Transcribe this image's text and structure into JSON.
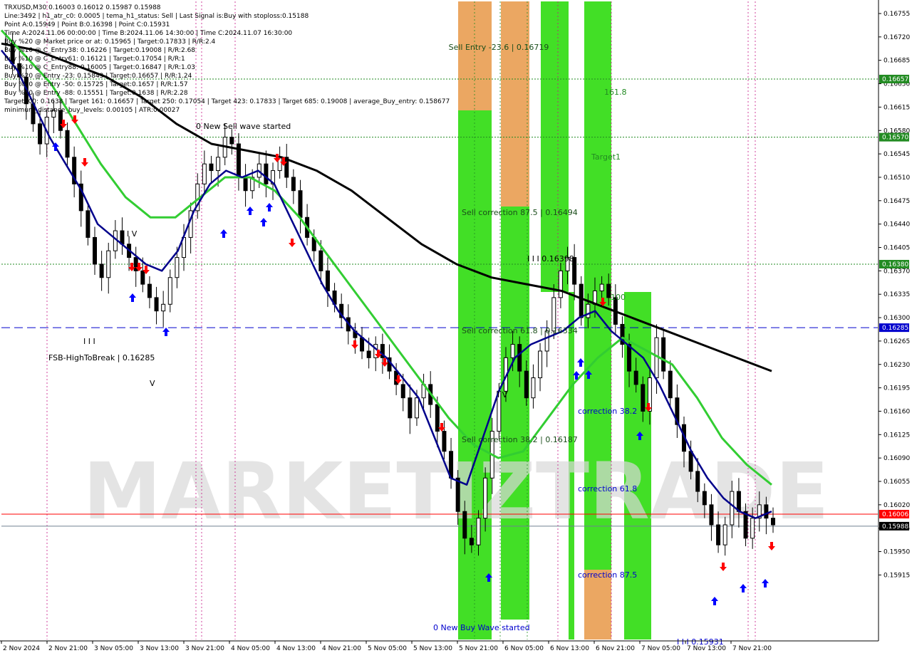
{
  "info_panel": {
    "lines": [
      "TRXUSD,M30  0.16003 0.16012 0.15987 0.15988",
      "Line:3492 | h1_atr_c0: 0.0005 | tema_h1_status: Sell | Last Signal is:Buy with stoploss:0.15188",
      "Point A:0.15949 | Point B:0.16398 | Point C:0.15931",
      "Time A:2024.11.06 00:00:00 | Time B:2024.11.06 14:30:00 | Time C:2024.11.07 16:30:00",
      "Buy %20 @ Market price or at: 0.15965 | Target:0.17833 | R/R:2.4",
      "Buy %10 @ C_Entry38: 0.16226 | Target:0.19008 | R/R:2.68",
      "Buy %10 @ C_Entry61: 0.16121 | Target:0.17054 | R/R:1",
      "Buy %10 @ C_Entry88: 0.16005 | Target:0.16847 | R/R:1.03",
      "Buy %20 @ Entry -23: 0.15843 | Target:0.16657 | R/R:1.24",
      "Buy %20 @ Entry -50: 0.15725 | Target:0.1657 | R/R:1.57",
      "Buy %20 @ Entry -88: 0.15551 | Target:0.1638 | R/R:2.28",
      "Target100: 0.1638 | Target 161: 0.16657 | Target 250: 0.17054 | Target 423: 0.17833 | Target 685: 0.19008 | average_Buy_entry: 0.158677",
      "minimum_distance_buy_levels: 0.00105 | ATR:0.00027"
    ]
  },
  "watermark": "MARKETIZTRADE",
  "annotations": {
    "sell_entry": "Sell Entry -23.6 | 0.16719",
    "sell_corr_875": "Sell correction 87.5 | 0.16494",
    "sell_corr_618": "Sell correction 61.8 | 0.16334",
    "sell_corr_382": "Sell correction 38.2 | 0.16187",
    "point_b": "I I I 0.16398",
    "new_sell_wave": "0 New Sell wave started",
    "new_buy_wave": "0 New Buy Wave started",
    "fsb": "FSB-HighToBreak | 0.16285",
    "t1618": "161.8",
    "target1": "Target1",
    "t100": "100",
    "corr_382": "correction 38.2",
    "corr_618": "correction 61.8",
    "corr_875": "correction 87.5",
    "iv": "I V",
    "iii": "I I I",
    "v": "V",
    "iv2": "I V",
    "bottom_label": "I I I 0.15931"
  },
  "colors": {
    "background": "#ffffff",
    "candle": "#000000",
    "ma_fast": "#00008b",
    "ma_mid": "#32cd32",
    "ma_slow": "#000000",
    "zone_green": "#32dc14",
    "zone_orange": "#e9a055",
    "level_green": "#228b22",
    "fsb_line": "#0000cd",
    "current_price": "#ff0000",
    "bid_line": "#708090",
    "buy_arrow": "#0000ff",
    "sell_arrow": "#ff0000",
    "grid_vertical_magenta": "#c71585"
  },
  "chart_data": {
    "type": "candlestick",
    "symbol": "TRXUSD",
    "timeframe": "M30",
    "ylim": [
      0.1592,
      0.1678
    ],
    "y_ticks": [
      "0.16755",
      "0.16720",
      "0.16685",
      "0.16650",
      "0.16615",
      "0.16580",
      "0.16545",
      "0.16510",
      "0.16475",
      "0.16440",
      "0.16405",
      "0.16370",
      "0.16335",
      "0.16300",
      "0.16265",
      "0.16230",
      "0.16195",
      "0.16160",
      "0.16125",
      "0.16090",
      "0.16055",
      "0.16020",
      "0.15985",
      "0.15950",
      "0.15915"
    ],
    "x_ticks": [
      "2 Nov 2024",
      "2 Nov 21:00",
      "3 Nov 05:00",
      "3 Nov 13:00",
      "3 Nov 21:00",
      "4 Nov 05:00",
      "4 Nov 13:00",
      "4 Nov 21:00",
      "5 Nov 05:00",
      "5 Nov 13:00",
      "5 Nov 21:00",
      "6 Nov 05:00",
      "6 Nov 13:00",
      "6 Nov 21:00",
      "7 Nov 05:00",
      "7 Nov 13:00",
      "7 Nov 21:00"
    ],
    "price_tags": [
      {
        "value": "0.16657",
        "color": "#228b22"
      },
      {
        "value": "0.16570",
        "color": "#228b22"
      },
      {
        "value": "0.16380",
        "color": "#228b22"
      },
      {
        "value": "0.16285",
        "color": "#0000cd"
      },
      {
        "value": "0.16006",
        "color": "#ff0000"
      },
      {
        "value": "0.15988",
        "color": "#000000"
      }
    ],
    "horizontal_levels": [
      {
        "price": 0.16657,
        "style": "dotted",
        "color": "#228b22"
      },
      {
        "price": 0.1657,
        "style": "dotted",
        "color": "#228b22"
      },
      {
        "price": 0.1638,
        "style": "dotted",
        "color": "#228b22"
      },
      {
        "price": 0.16285,
        "style": "dashed",
        "color": "#0000cd"
      },
      {
        "price": 0.16006,
        "style": "solid",
        "color": "#ff0000"
      },
      {
        "price": 0.15988,
        "style": "solid",
        "color": "#708090"
      }
    ],
    "close_path": [
      0.1671,
      0.1668,
      0.1666,
      0.1662,
      0.1659,
      0.1656,
      0.166,
      0.1661,
      0.1658,
      0.1654,
      0.165,
      0.1646,
      0.1642,
      0.1638,
      0.1636,
      0.164,
      0.1643,
      0.1641,
      0.1639,
      0.1637,
      0.1635,
      0.1633,
      0.1631,
      0.1632,
      0.1636,
      0.1639,
      0.1642,
      0.1646,
      0.165,
      0.1653,
      0.1652,
      0.1654,
      0.1657,
      0.1656,
      0.1651,
      0.1649,
      0.1651,
      0.1653,
      0.165,
      0.1652,
      0.1654,
      0.1651,
      0.1649,
      0.1645,
      0.1642,
      0.164,
      0.1637,
      0.1634,
      0.1632,
      0.163,
      0.1628,
      0.1627,
      0.1625,
      0.1624,
      0.1626,
      0.1624,
      0.1622,
      0.162,
      0.1618,
      0.1615,
      0.1618,
      0.162,
      0.1617,
      0.1613,
      0.161,
      0.1606,
      0.1601,
      0.1597,
      0.1596,
      0.16,
      0.1606,
      0.1613,
      0.1619,
      0.1624,
      0.1626,
      0.1622,
      0.1618,
      0.1621,
      0.1625,
      0.1628,
      0.1633,
      0.1637,
      0.1639,
      0.1635,
      0.163,
      0.1632,
      0.1634,
      0.1635,
      0.1633,
      0.1629,
      0.1626,
      0.1622,
      0.162,
      0.1616,
      0.1621,
      0.1627,
      0.1622,
      0.1618,
      0.1614,
      0.161,
      0.1607,
      0.1604,
      0.1602,
      0.1599,
      0.1596,
      0.1599,
      0.1604,
      0.1601,
      0.1597,
      0.16,
      0.1602,
      0.16,
      0.1599
    ],
    "ma_fast_path": [
      0.167,
      0.1667,
      0.1662,
      0.1657,
      0.1653,
      0.1649,
      0.1644,
      0.1642,
      0.164,
      0.1638,
      0.1637,
      0.164,
      0.1646,
      0.165,
      0.1652,
      0.1651,
      0.1652,
      0.165,
      0.1645,
      0.164,
      0.1635,
      0.1631,
      0.1628,
      0.1626,
      0.1624,
      0.1621,
      0.1618,
      0.1612,
      0.1606,
      0.1605,
      0.1612,
      0.1619,
      0.1624,
      0.1626,
      0.1627,
      0.1628,
      0.163,
      0.1631,
      0.1628,
      0.1626,
      0.1624,
      0.162,
      0.1615,
      0.161,
      0.1606,
      0.1603,
      0.1601,
      0.16,
      0.1601
    ],
    "ma_mid_path": [
      0.1673,
      0.1669,
      0.1665,
      0.1659,
      0.1653,
      0.1648,
      0.1645,
      0.1645,
      0.1648,
      0.1651,
      0.1651,
      0.1649,
      0.1645,
      0.164,
      0.1635,
      0.163,
      0.1625,
      0.162,
      0.1615,
      0.1611,
      0.1609,
      0.161,
      0.1615,
      0.162,
      0.1624,
      0.1627,
      0.1625,
      0.1623,
      0.1618,
      0.1612,
      0.1608,
      0.1605
    ],
    "ma_slow_path": [
      0.1671,
      0.167,
      0.1668,
      0.1666,
      0.1663,
      0.1659,
      0.1656,
      0.1655,
      0.1654,
      0.1652,
      0.1649,
      0.1645,
      0.1641,
      0.1638,
      0.1636,
      0.1635,
      0.1634,
      0.1632,
      0.163,
      0.1628,
      0.1626,
      0.1624,
      0.1622
    ]
  }
}
